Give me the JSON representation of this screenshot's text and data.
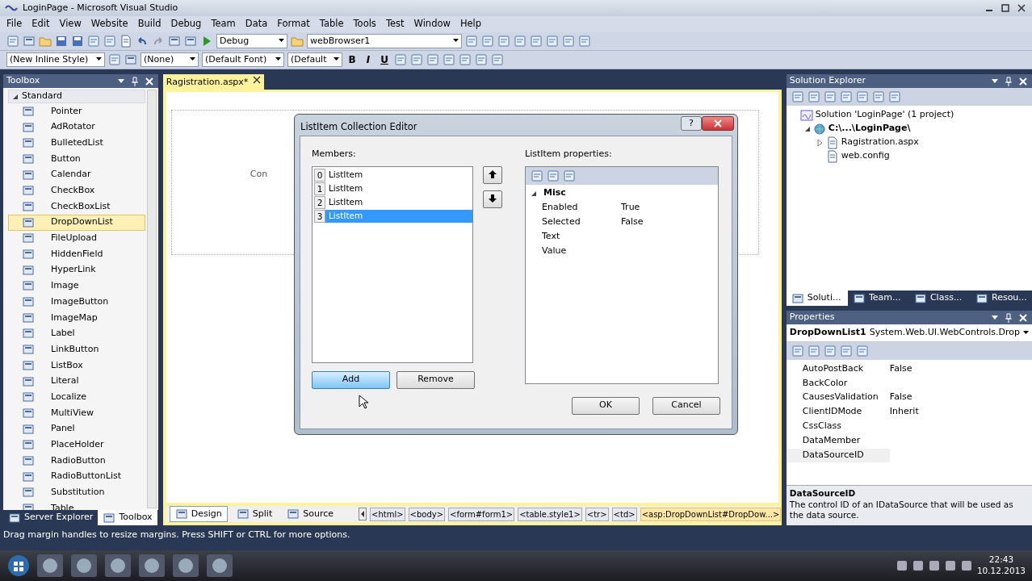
{
  "window": {
    "title": "LoginPage - Microsoft Visual Studio"
  },
  "menu": [
    "File",
    "Edit",
    "View",
    "Website",
    "Build",
    "Debug",
    "Team",
    "Data",
    "Format",
    "Table",
    "Tools",
    "Test",
    "Window",
    "Help"
  ],
  "toolbar": {
    "configuration": "Debug",
    "target": "webBrowser1"
  },
  "format_toolbar": {
    "style": "(New Inline Style)",
    "block": "(None)",
    "font": "(Default Font)",
    "size": "(Default",
    "buttons": [
      "B",
      "I",
      "U"
    ]
  },
  "toolbox": {
    "title": "Toolbox",
    "group": {
      "label": "Standard",
      "expanded": true,
      "items": [
        {
          "label": "Pointer",
          "selected": false
        },
        {
          "label": "AdRotator",
          "selected": false
        },
        {
          "label": "BulletedList",
          "selected": false
        },
        {
          "label": "Button",
          "selected": false
        },
        {
          "label": "Calendar",
          "selected": false
        },
        {
          "label": "CheckBox",
          "selected": false
        },
        {
          "label": "CheckBoxList",
          "selected": false
        },
        {
          "label": "DropDownList",
          "selected": true
        },
        {
          "label": "FileUpload",
          "selected": false
        },
        {
          "label": "HiddenField",
          "selected": false
        },
        {
          "label": "HyperLink",
          "selected": false
        },
        {
          "label": "Image",
          "selected": false
        },
        {
          "label": "ImageButton",
          "selected": false
        },
        {
          "label": "ImageMap",
          "selected": false
        },
        {
          "label": "Label",
          "selected": false
        },
        {
          "label": "LinkButton",
          "selected": false
        },
        {
          "label": "ListBox",
          "selected": false
        },
        {
          "label": "Literal",
          "selected": false
        },
        {
          "label": "Localize",
          "selected": false
        },
        {
          "label": "MultiView",
          "selected": false
        },
        {
          "label": "Panel",
          "selected": false
        },
        {
          "label": "PlaceHolder",
          "selected": false
        },
        {
          "label": "RadioButton",
          "selected": false
        },
        {
          "label": "RadioButtonList",
          "selected": false
        },
        {
          "label": "Substitution",
          "selected": false
        },
        {
          "label": "Table",
          "selected": false
        }
      ]
    },
    "tabs": [
      {
        "label": "Server Explorer",
        "selected": false
      },
      {
        "label": "Toolbox",
        "selected": true
      }
    ]
  },
  "editor": {
    "tab": {
      "label": "Ragistration.aspx*"
    },
    "design_labels": [
      "Con"
    ],
    "views": [
      {
        "label": "Design",
        "selected": true
      },
      {
        "label": "Split",
        "selected": false
      },
      {
        "label": "Source",
        "selected": false
      }
    ],
    "breadcrumbs": [
      {
        "label": "<html>",
        "selected": false
      },
      {
        "label": "<body>",
        "selected": false
      },
      {
        "label": "<form#form1>",
        "selected": false
      },
      {
        "label": "<table.style1>",
        "selected": false
      },
      {
        "label": "<tr>",
        "selected": false
      },
      {
        "label": "<td>",
        "selected": false
      },
      {
        "label": "<asp:DropDownList#DropDow...>",
        "selected": true
      }
    ]
  },
  "dialog": {
    "title": "ListItem Collection Editor",
    "help": "?",
    "members_label": "Members:",
    "members": [
      {
        "index": "0",
        "label": "ListItem",
        "selected": false
      },
      {
        "index": "1",
        "label": "ListItem",
        "selected": false
      },
      {
        "index": "2",
        "label": "ListItem",
        "selected": false
      },
      {
        "index": "3",
        "label": "ListItem",
        "selected": true
      }
    ],
    "list_buttons": [
      {
        "label": "Add",
        "hovered": true
      },
      {
        "label": "Remove",
        "hovered": false
      }
    ],
    "properties_label": "ListItem properties:",
    "category": {
      "label": "Misc",
      "expanded": true,
      "properties": [
        {
          "name": "Enabled",
          "value": "True"
        },
        {
          "name": "Selected",
          "value": "False"
        },
        {
          "name": "Text"
        },
        {
          "name": "Value"
        }
      ]
    },
    "buttons": [
      "OK",
      "Cancel"
    ]
  },
  "solution_explorer": {
    "title": "Solution Explorer",
    "tree": [
      {
        "label": "Solution 'LoginPage' (1 project)",
        "children": [
          {
            "label": "C:\\...\\LoginPage\\",
            "expanded": true,
            "bold": true,
            "children": [
              {
                "label": "Ragistration.aspx",
                "expanded": false
              },
              {
                "label": "web.config"
              }
            ]
          }
        ]
      }
    ],
    "tabs": [
      {
        "label": "Soluti...",
        "selected": true
      },
      {
        "label": "Team...",
        "selected": false
      },
      {
        "label": "Class...",
        "selected": false
      },
      {
        "label": "Resou...",
        "selected": false
      }
    ]
  },
  "properties": {
    "title": "Properties",
    "object": "DropDownList1",
    "type": "System.Web.UI.WebControls.Drop",
    "rows": [
      {
        "name": "AutoPostBack",
        "value": "False",
        "selected": false
      },
      {
        "name": "BackColor",
        "value": "",
        "selected": false
      },
      {
        "name": "CausesValidation",
        "value": "False",
        "selected": false
      },
      {
        "name": "ClientIDMode",
        "value": "Inherit",
        "selected": false
      },
      {
        "name": "CssClass",
        "value": "",
        "selected": false
      },
      {
        "name": "DataMember",
        "value": "",
        "selected": false
      },
      {
        "name": "DataSourceID",
        "value": "",
        "selected": true
      }
    ],
    "description": {
      "title": "DataSourceID",
      "text": "The control ID of an IDataSource that will be used as the data source."
    }
  },
  "status_bar": "Drag margin handles to resize margins. Press SHIFT or CTRL for more options.",
  "taskbar": {
    "time": "22:43",
    "date": "10.12.2013"
  }
}
